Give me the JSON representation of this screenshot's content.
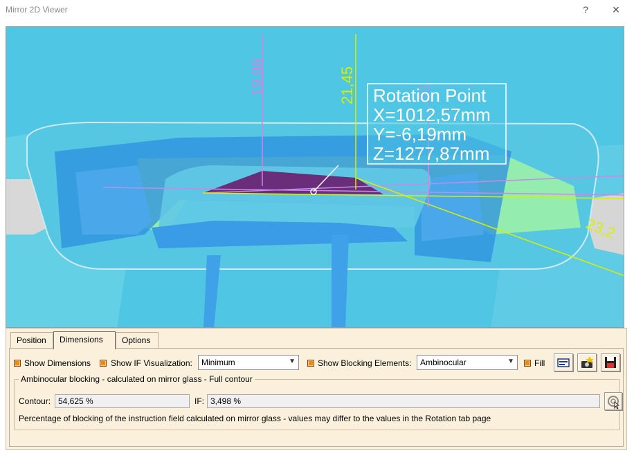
{
  "window": {
    "title": "Mirror 2D Viewer",
    "help_glyph": "?",
    "close_glyph": "✕"
  },
  "viewer": {
    "rotation_point": {
      "title": "Rotation Point",
      "x": "X=1012,57mm",
      "y": "Y=-6,19mm",
      "z": "Z=1277,87mm"
    },
    "dimensions": [
      "19,98",
      "21,45",
      "29",
      "23,2"
    ],
    "colors": {
      "background": "#4fc6e4",
      "mirror_blue": "#2e8fe0",
      "field_green": "#9ff2a6",
      "purple": "#6a2d7a",
      "yellow": "#d8f000",
      "magenta_dim": "#c68ae8"
    }
  },
  "tabs": [
    {
      "label": "Position",
      "active": false
    },
    {
      "label": "Dimensions",
      "active": true
    },
    {
      "label": "Options",
      "active": false
    }
  ],
  "controls": {
    "show_dimensions": "Show Dimensions",
    "show_if_visualization": "Show IF Visualization:",
    "if_visualization_value": "Minimum",
    "show_blocking_elements": "Show Blocking Elements:",
    "blocking_elements_value": "Ambinocular",
    "fill": "Fill"
  },
  "group": {
    "title": "Ambinocular blocking - calculated on mirror glass - Full contour",
    "contour_label": "Contour:",
    "contour_value": "54,625 %",
    "if_label": "IF:",
    "if_value": "3,498 %",
    "note": "Percentage of blocking of the instruction field calculated on mirror glass - values may differ to the values in the Rotation tab page"
  },
  "icons": [
    "display-settings-icon",
    "capture-camera-icon",
    "save-disk-icon",
    "refresh-icon"
  ]
}
